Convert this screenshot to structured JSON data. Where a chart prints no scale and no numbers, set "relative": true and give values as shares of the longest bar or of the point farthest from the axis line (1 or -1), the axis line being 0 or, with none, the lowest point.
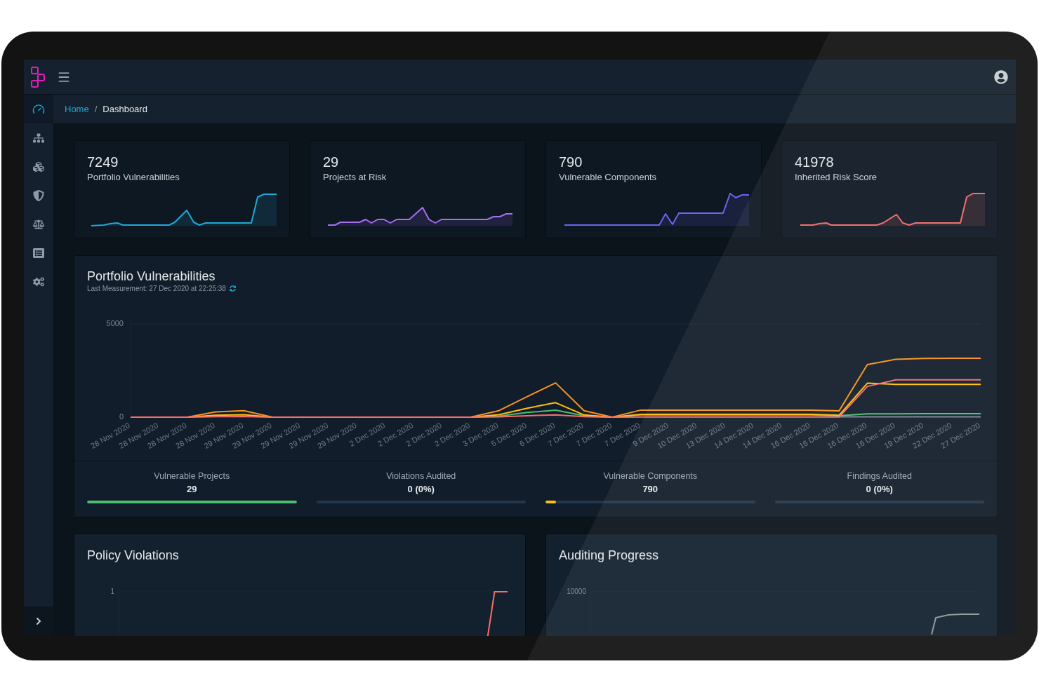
{
  "sidebar": {
    "items": [
      {
        "selected": true
      },
      {
        "selected": false
      },
      {
        "selected": false
      },
      {
        "selected": false
      },
      {
        "selected": false
      },
      {
        "selected": false
      },
      {
        "selected": false
      }
    ]
  },
  "breadcrumb": {
    "items": [
      {
        "label": "Home",
        "kind": "link"
      },
      {
        "label": "Dashboard",
        "kind": "current"
      }
    ],
    "separator": "/"
  },
  "metric_cards": [
    {
      "value": "7249",
      "label": "Portfolio Vulnerabilities",
      "color": "#20a8d8"
    },
    {
      "value": "29",
      "label": "Projects at Risk",
      "color": "#a66ef0"
    },
    {
      "value": "790",
      "label": "Vulnerable Components",
      "color": "#6a64f0"
    },
    {
      "value": "41978",
      "label": "Inherited Risk Score",
      "color": "#f0696b"
    }
  ],
  "portfolio_panel": {
    "title": "Portfolio Vulnerabilities",
    "subtitle": "Last Measurement: 27 Dec 2020 at 22:25:38",
    "chart_data": {
      "type": "line",
      "categories": [
        "28 Nov 2020",
        "28 Nov 2020",
        "28 Nov 2020",
        "28 Nov 2020",
        "29 Nov 2020",
        "29 Nov 2020",
        "29 Nov 2020",
        "29 Nov 2020",
        "29 Nov 2020",
        "2 Dec 2020",
        "2 Dec 2020",
        "2 Dec 2020",
        "2 Dec 2020",
        "3 Dec 2020",
        "5 Dec 2020",
        "6 Dec 2020",
        "7 Dec 2020",
        "7 Dec 2020",
        "7 Dec 2020",
        "9 Dec 2020",
        "10 Dec 2020",
        "13 Dec 2020",
        "14 Dec 2020",
        "14 Dec 2020",
        "16 Dec 2020",
        "16 Dec 2020",
        "16 Dec 2020",
        "16 Dec 2020",
        "19 Dec 2020",
        "22 Dec 2020",
        "27 Dec 2020"
      ],
      "ylim": [
        0,
        5000
      ],
      "yticks": [
        0,
        5000
      ],
      "series": [
        {
          "color": "#73818f",
          "values": [
            null,
            null,
            null,
            null,
            null,
            null,
            null,
            null,
            null,
            null,
            null,
            null,
            null,
            null,
            null,
            null,
            null,
            null,
            null,
            null,
            null,
            null,
            null,
            null,
            null,
            20,
            20,
            20,
            20,
            20,
            20
          ]
        },
        {
          "color": "#4dbd74",
          "values": [
            null,
            null,
            null,
            null,
            null,
            null,
            null,
            null,
            null,
            null,
            null,
            null,
            0,
            60,
            250,
            380,
            80,
            0,
            120,
            120,
            120,
            120,
            120,
            120,
            120,
            80,
            180,
            180,
            190,
            190,
            190
          ]
        },
        {
          "color": "#ffc107",
          "values": [
            0,
            0,
            0,
            100,
            130,
            0,
            0,
            0,
            0,
            0,
            0,
            0,
            0,
            130,
            480,
            780,
            120,
            0,
            150,
            150,
            150,
            150,
            150,
            150,
            150,
            100,
            1820,
            1760,
            1760,
            1760,
            1760
          ]
        },
        {
          "color": "#f8921e",
          "values": [
            0,
            0,
            0,
            280,
            350,
            0,
            0,
            0,
            0,
            0,
            0,
            0,
            0,
            350,
            1100,
            1840,
            350,
            0,
            380,
            380,
            380,
            380,
            380,
            380,
            380,
            340,
            2820,
            3100,
            3150,
            3160,
            3160
          ]
        },
        {
          "color": "#f86c6b",
          "values": [
            0,
            0,
            0,
            30,
            40,
            0,
            0,
            0,
            0,
            0,
            0,
            0,
            0,
            20,
            80,
            120,
            30,
            0,
            10,
            10,
            10,
            10,
            10,
            10,
            10,
            10,
            1650,
            2000,
            2000,
            2000,
            2000
          ]
        }
      ]
    },
    "stats": [
      {
        "label": "Vulnerable Projects",
        "value": "29",
        "level": 1,
        "color": "#4dbd74"
      },
      {
        "label": "Violations Audited",
        "value": "0 (0%)",
        "level": 0
      },
      {
        "label": "Vulnerable Components",
        "value": "790",
        "level": 0.05,
        "color": "#ffc107"
      },
      {
        "label": "Findings Audited",
        "value": "0 (0%)",
        "level": 0
      }
    ]
  },
  "bottom_panels": [
    {
      "title": "Policy Violations",
      "chart_data": {
        "type": "line",
        "relative": true,
        "categories": [
          null,
          null,
          null,
          null,
          null,
          null,
          null,
          null,
          null,
          null,
          null,
          null,
          null,
          null,
          null,
          null,
          null,
          null,
          null,
          null,
          null,
          null,
          null,
          null,
          null,
          null,
          null,
          null,
          null,
          null,
          null
        ],
        "annotations": [
          {
            "text": "1"
          }
        ],
        "series": [
          {
            "color": "#f86c6b",
            "values": [
              null,
              null,
              null,
              null,
              null,
              null,
              null,
              null,
              null,
              null,
              null,
              null,
              null,
              null,
              null,
              null,
              null,
              null,
              null,
              null,
              null,
              null,
              null,
              null,
              null,
              null,
              null,
              null,
              0,
              1,
              1
            ]
          }
        ]
      }
    },
    {
      "title": "Auditing Progress",
      "axis_label": "10000"
    }
  ]
}
